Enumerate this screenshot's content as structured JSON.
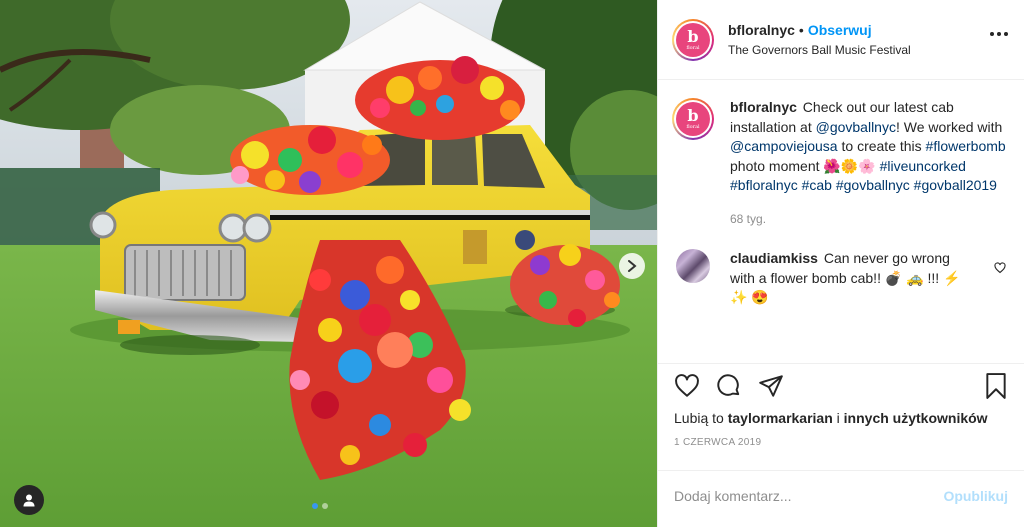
{
  "post": {
    "author": {
      "username": "bfloralnyc",
      "avatar_letter": "b",
      "avatar_sub": "floral"
    },
    "follow_label": "Obserwuj",
    "separator": "•",
    "location": "The Governors Ball Music Festival",
    "caption": {
      "username": "bfloralnyc",
      "text_1": "Check out our latest cab installation at ",
      "mention_1": "@govballnyc",
      "text_2": "! We worked with ",
      "mention_2": "@campoviejousa",
      "text_3": " to create this ",
      "hashtag_1": "#flowerbomb",
      "text_4": " photo moment 🌺🌼🌸 ",
      "hashtag_2": "#liveuncorked",
      "hashtag_3": "#bfloralnyc",
      "hashtag_4": "#cab",
      "hashtag_5": "#govballnyc",
      "hashtag_6": "#govball2019",
      "age": "68 tyg."
    },
    "comment": {
      "username": "claudiamkiss",
      "text": "Can never go wrong with a flower bomb cab!! 💣 🚕 !!! ⚡ ✨ 😍"
    },
    "likes": {
      "prefix": "Lubią to ",
      "user": "taylormarkarian",
      "mid": " i ",
      "others": "innych użytkowników"
    },
    "date": "1 CZERWCA 2019",
    "add_comment": {
      "placeholder": "Dodaj komentarz...",
      "post_label": "Opublikuj"
    },
    "carousel": {
      "slide_count": 2,
      "active_index": 0
    },
    "colors": {
      "accent": "#0095f6",
      "post_disabled": "#b2dffc",
      "carousel_active": "#3897f0"
    }
  }
}
